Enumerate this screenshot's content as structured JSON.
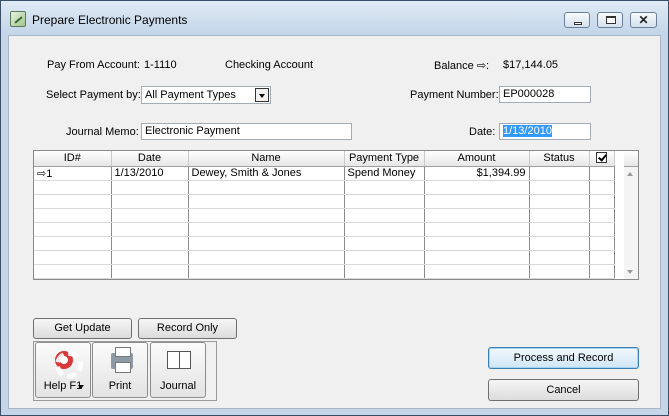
{
  "window": {
    "title": "Prepare Electronic Payments"
  },
  "header": {
    "pay_from_label": "Pay From Account:",
    "account_number": "1-1110",
    "account_name": "Checking Account",
    "balance_label": "Balance",
    "balance_suffix": ":",
    "balance_value": "$17,144.05",
    "select_payment_label": "Select Payment by:",
    "select_payment_value": "All Payment Types",
    "payment_number_label": "Payment Number:",
    "payment_number_value": "EP000028",
    "journal_memo_label": "Journal Memo:",
    "journal_memo_value": "Electronic Payment",
    "date_label": "Date:",
    "date_value": "1/13/2010"
  },
  "table": {
    "columns": [
      "ID#",
      "Date",
      "Name",
      "Payment Type",
      "Amount",
      "Status"
    ],
    "rows": [
      {
        "id": "1",
        "date": "1/13/2010",
        "name": "Dewey, Smith & Jones",
        "type": "Spend Money",
        "amount": "$1,394.99",
        "status": ""
      }
    ]
  },
  "buttons": {
    "get_update": "Get Update",
    "record_only": "Record Only",
    "help": "Help F1",
    "print": "Print",
    "journal": "Journal",
    "process_record": "Process and Record",
    "cancel": "Cancel"
  },
  "icons": {
    "arrow": "⇨",
    "close": "✕"
  }
}
